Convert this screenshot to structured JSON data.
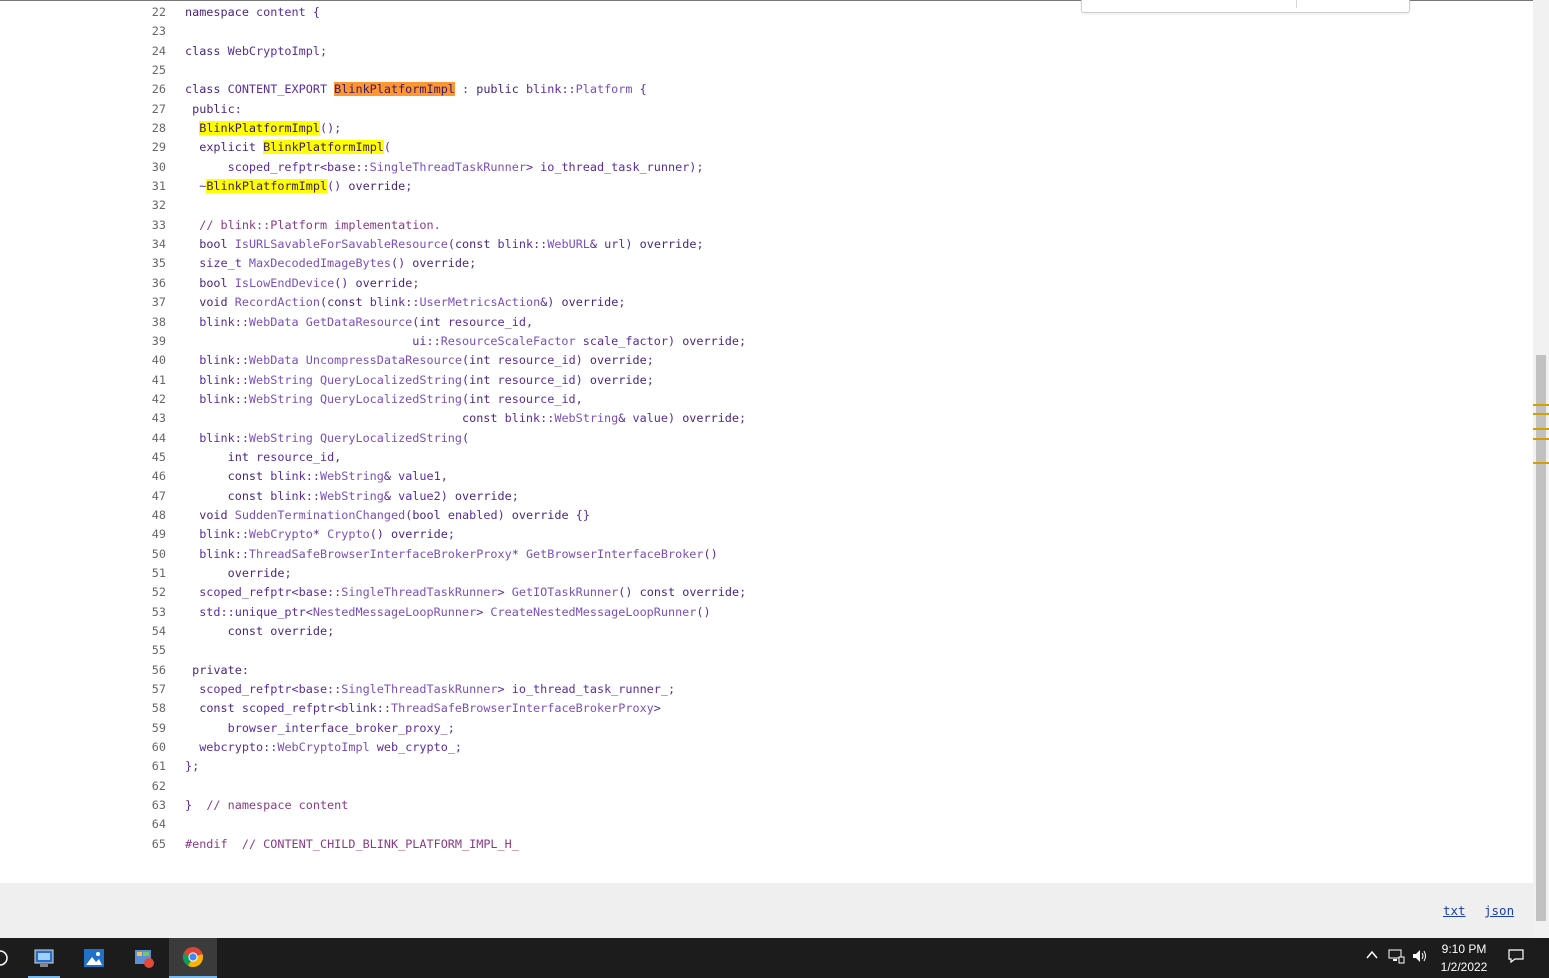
{
  "code": {
    "lines": [
      {
        "n": "22",
        "parts": [
          [
            "kw",
            "namespace"
          ],
          [
            "",
            " content {"
          ]
        ]
      },
      {
        "n": "23",
        "parts": []
      },
      {
        "n": "24",
        "parts": [
          [
            "kw",
            "class"
          ],
          [
            "",
            " WebCryptoImpl;"
          ]
        ]
      },
      {
        "n": "25",
        "parts": []
      },
      {
        "n": "26",
        "parts": [
          [
            "kw",
            "class"
          ],
          [
            "",
            " CONTENT_EXPORT "
          ],
          [
            "cur",
            "BlinkPlatformImpl"
          ],
          [
            "",
            " : "
          ],
          [
            "kw",
            "public"
          ],
          [
            "",
            " blink::"
          ],
          [
            "ty",
            "Platform"
          ],
          [
            "",
            " {"
          ]
        ]
      },
      {
        "n": "27",
        "parts": [
          [
            "",
            " "
          ],
          [
            "kw",
            "public"
          ],
          [
            "",
            ":"
          ]
        ]
      },
      {
        "n": "28",
        "parts": [
          [
            "",
            "  "
          ],
          [
            "hl",
            "BlinkPlatformImpl"
          ],
          [
            "",
            "();"
          ]
        ]
      },
      {
        "n": "29",
        "parts": [
          [
            "",
            "  "
          ],
          [
            "kw",
            "explicit"
          ],
          [
            "",
            " "
          ],
          [
            "hl",
            "BlinkPlatformImpl"
          ],
          [
            "",
            "("
          ]
        ]
      },
      {
        "n": "30",
        "parts": [
          [
            "",
            "      scoped_refptr<base::"
          ],
          [
            "ty",
            "SingleThreadTaskRunner"
          ],
          [
            "",
            "> io_thread_task_runner);"
          ]
        ]
      },
      {
        "n": "31",
        "parts": [
          [
            "",
            "  ~"
          ],
          [
            "hl",
            "BlinkPlatformImpl"
          ],
          [
            "",
            "() "
          ],
          [
            "kw",
            "override"
          ],
          [
            "",
            ";"
          ]
        ]
      },
      {
        "n": "32",
        "parts": []
      },
      {
        "n": "33",
        "parts": [
          [
            "",
            "  "
          ],
          [
            "cm",
            "// blink::Platform implementation."
          ]
        ]
      },
      {
        "n": "34",
        "parts": [
          [
            "",
            "  "
          ],
          [
            "kw",
            "bool"
          ],
          [
            "",
            " "
          ],
          [
            "ty",
            "IsURLSavableForSavableResource"
          ],
          [
            "",
            "("
          ],
          [
            "kw",
            "const"
          ],
          [
            "",
            " blink::"
          ],
          [
            "ty",
            "WebURL"
          ],
          [
            "",
            "& url) "
          ],
          [
            "kw",
            "override"
          ],
          [
            "",
            ";"
          ]
        ]
      },
      {
        "n": "35",
        "parts": [
          [
            "",
            "  size_t "
          ],
          [
            "ty",
            "MaxDecodedImageBytes"
          ],
          [
            "",
            "() "
          ],
          [
            "kw",
            "override"
          ],
          [
            "",
            ";"
          ]
        ]
      },
      {
        "n": "36",
        "parts": [
          [
            "",
            "  "
          ],
          [
            "kw",
            "bool"
          ],
          [
            "",
            " "
          ],
          [
            "ty",
            "IsLowEndDevice"
          ],
          [
            "",
            "() "
          ],
          [
            "kw",
            "override"
          ],
          [
            "",
            ";"
          ]
        ]
      },
      {
        "n": "37",
        "parts": [
          [
            "",
            "  "
          ],
          [
            "kw",
            "void"
          ],
          [
            "",
            " "
          ],
          [
            "ty",
            "RecordAction"
          ],
          [
            "",
            "("
          ],
          [
            "kw",
            "const"
          ],
          [
            "",
            " blink::"
          ],
          [
            "ty",
            "UserMetricsAction"
          ],
          [
            "",
            "&) "
          ],
          [
            "kw",
            "override"
          ],
          [
            "",
            ";"
          ]
        ]
      },
      {
        "n": "38",
        "parts": [
          [
            "",
            "  blink::"
          ],
          [
            "ty",
            "WebData"
          ],
          [
            "",
            " "
          ],
          [
            "ty",
            "GetDataResource"
          ],
          [
            "",
            "("
          ],
          [
            "kw",
            "int"
          ],
          [
            "",
            " resource_id,"
          ]
        ]
      },
      {
        "n": "39",
        "parts": [
          [
            "",
            "                                ui::"
          ],
          [
            "ty",
            "ResourceScaleFactor"
          ],
          [
            "",
            " scale_factor) "
          ],
          [
            "kw",
            "override"
          ],
          [
            "",
            ";"
          ]
        ]
      },
      {
        "n": "40",
        "parts": [
          [
            "",
            "  blink::"
          ],
          [
            "ty",
            "WebData"
          ],
          [
            "",
            " "
          ],
          [
            "ty",
            "UncompressDataResource"
          ],
          [
            "",
            "("
          ],
          [
            "kw",
            "int"
          ],
          [
            "",
            " resource_id) "
          ],
          [
            "kw",
            "override"
          ],
          [
            "",
            ";"
          ]
        ]
      },
      {
        "n": "41",
        "parts": [
          [
            "",
            "  blink::"
          ],
          [
            "ty",
            "WebString"
          ],
          [
            "",
            " "
          ],
          [
            "ty",
            "QueryLocalizedString"
          ],
          [
            "",
            "("
          ],
          [
            "kw",
            "int"
          ],
          [
            "",
            " resource_id) "
          ],
          [
            "kw",
            "override"
          ],
          [
            "",
            ";"
          ]
        ]
      },
      {
        "n": "42",
        "parts": [
          [
            "",
            "  blink::"
          ],
          [
            "ty",
            "WebString"
          ],
          [
            "",
            " "
          ],
          [
            "ty",
            "QueryLocalizedString"
          ],
          [
            "",
            "("
          ],
          [
            "kw",
            "int"
          ],
          [
            "",
            " resource_id,"
          ]
        ]
      },
      {
        "n": "43",
        "parts": [
          [
            "",
            "                                       "
          ],
          [
            "kw",
            "const"
          ],
          [
            "",
            " blink::"
          ],
          [
            "ty",
            "WebString"
          ],
          [
            "",
            "& value) "
          ],
          [
            "kw",
            "override"
          ],
          [
            "",
            ";"
          ]
        ]
      },
      {
        "n": "44",
        "parts": [
          [
            "",
            "  blink::"
          ],
          [
            "ty",
            "WebString"
          ],
          [
            "",
            " "
          ],
          [
            "ty",
            "QueryLocalizedString"
          ],
          [
            "",
            "("
          ]
        ]
      },
      {
        "n": "45",
        "parts": [
          [
            "",
            "      "
          ],
          [
            "kw",
            "int"
          ],
          [
            "",
            " resource_id,"
          ]
        ]
      },
      {
        "n": "46",
        "parts": [
          [
            "",
            "      "
          ],
          [
            "kw",
            "const"
          ],
          [
            "",
            " blink::"
          ],
          [
            "ty",
            "WebString"
          ],
          [
            "",
            "& value1,"
          ]
        ]
      },
      {
        "n": "47",
        "parts": [
          [
            "",
            "      "
          ],
          [
            "kw",
            "const"
          ],
          [
            "",
            " blink::"
          ],
          [
            "ty",
            "WebString"
          ],
          [
            "",
            "& value2) "
          ],
          [
            "kw",
            "override"
          ],
          [
            "",
            ";"
          ]
        ]
      },
      {
        "n": "48",
        "parts": [
          [
            "",
            "  "
          ],
          [
            "kw",
            "void"
          ],
          [
            "",
            " "
          ],
          [
            "ty",
            "SuddenTerminationChanged"
          ],
          [
            "",
            "("
          ],
          [
            "kw",
            "bool"
          ],
          [
            "",
            " enabled) "
          ],
          [
            "kw",
            "override"
          ],
          [
            "",
            " {}"
          ]
        ]
      },
      {
        "n": "49",
        "parts": [
          [
            "",
            "  blink::"
          ],
          [
            "ty",
            "WebCrypto"
          ],
          [
            "",
            "* "
          ],
          [
            "ty",
            "Crypto"
          ],
          [
            "",
            "() "
          ],
          [
            "kw",
            "override"
          ],
          [
            "",
            ";"
          ]
        ]
      },
      {
        "n": "50",
        "parts": [
          [
            "",
            "  blink::"
          ],
          [
            "ty",
            "ThreadSafeBrowserInterfaceBrokerProxy"
          ],
          [
            "",
            "* "
          ],
          [
            "ty",
            "GetBrowserInterfaceBroker"
          ],
          [
            "",
            "()"
          ]
        ]
      },
      {
        "n": "51",
        "parts": [
          [
            "",
            "      "
          ],
          [
            "kw",
            "override"
          ],
          [
            "",
            ";"
          ]
        ]
      },
      {
        "n": "52",
        "parts": [
          [
            "",
            "  scoped_refptr<base::"
          ],
          [
            "ty",
            "SingleThreadTaskRunner"
          ],
          [
            "",
            "> "
          ],
          [
            "ty",
            "GetIOTaskRunner"
          ],
          [
            "",
            "() "
          ],
          [
            "kw",
            "const"
          ],
          [
            "",
            " "
          ],
          [
            "kw",
            "override"
          ],
          [
            "",
            ";"
          ]
        ]
      },
      {
        "n": "53",
        "parts": [
          [
            "",
            "  std::unique_ptr<"
          ],
          [
            "ty",
            "NestedMessageLoopRunner"
          ],
          [
            "",
            "> "
          ],
          [
            "ty",
            "CreateNestedMessageLoopRunner"
          ],
          [
            "",
            "()"
          ]
        ]
      },
      {
        "n": "54",
        "parts": [
          [
            "",
            "      "
          ],
          [
            "kw",
            "const"
          ],
          [
            "",
            " "
          ],
          [
            "kw",
            "override"
          ],
          [
            "",
            ";"
          ]
        ]
      },
      {
        "n": "55",
        "parts": []
      },
      {
        "n": "56",
        "parts": [
          [
            "",
            " "
          ],
          [
            "kw",
            "private"
          ],
          [
            "",
            ":"
          ]
        ]
      },
      {
        "n": "57",
        "parts": [
          [
            "",
            "  scoped_refptr<base::"
          ],
          [
            "ty",
            "SingleThreadTaskRunner"
          ],
          [
            "",
            "> io_thread_task_runner_;"
          ]
        ]
      },
      {
        "n": "58",
        "parts": [
          [
            "",
            "  "
          ],
          [
            "kw",
            "const"
          ],
          [
            "",
            " scoped_refptr<blink::"
          ],
          [
            "ty",
            "ThreadSafeBrowserInterfaceBrokerProxy"
          ],
          [
            "",
            ">"
          ]
        ]
      },
      {
        "n": "59",
        "parts": [
          [
            "",
            "      browser_interface_broker_proxy_;"
          ]
        ]
      },
      {
        "n": "60",
        "parts": [
          [
            "",
            "  webcrypto::"
          ],
          [
            "ty",
            "WebCryptoImpl"
          ],
          [
            "",
            " web_crypto_;"
          ]
        ]
      },
      {
        "n": "61",
        "parts": [
          [
            "",
            "};"
          ]
        ]
      },
      {
        "n": "62",
        "parts": []
      },
      {
        "n": "63",
        "parts": [
          [
            "",
            "}  "
          ],
          [
            "cm",
            "// namespace content"
          ]
        ]
      },
      {
        "n": "64",
        "parts": []
      },
      {
        "n": "65",
        "parts": [
          [
            "pp",
            "#endif"
          ],
          [
            "",
            "  "
          ],
          [
            "cm",
            "// CONTENT_CHILD_BLINK_PLATFORM_IMPL_H_"
          ]
        ]
      }
    ]
  },
  "footer": {
    "txt_link": "txt",
    "json_link": "json"
  },
  "taskbar": {
    "apps": [
      {
        "name": "start-partial-icon",
        "active": false
      },
      {
        "name": "remote-desktop-icon",
        "active": false
      },
      {
        "name": "photos-icon",
        "active": false
      },
      {
        "name": "control-panel-icon",
        "active": false
      },
      {
        "name": "chrome-icon",
        "active": true
      }
    ],
    "clock_time": "9:10 PM",
    "clock_date": "1/2/2022"
  },
  "colors": {
    "current_match": "#ff9632",
    "other_match": "#ffff00",
    "footer_bg": "#efefef",
    "taskbar_bg": "#1c1c1c",
    "scroll_marker": "#d2a000"
  }
}
